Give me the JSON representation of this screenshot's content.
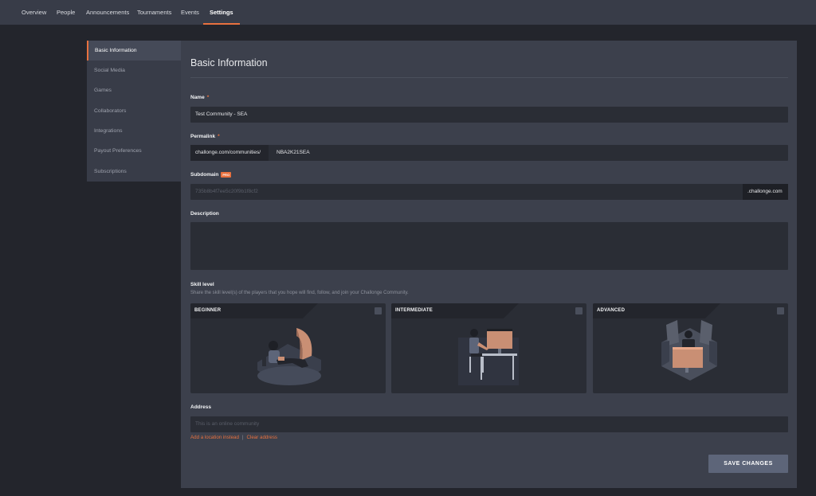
{
  "nav": {
    "tabs": [
      {
        "label": "Overview"
      },
      {
        "label": "People"
      },
      {
        "label": "Announcements"
      },
      {
        "label": "Tournaments"
      },
      {
        "label": "Events"
      },
      {
        "label": "Settings"
      }
    ],
    "active": "Settings"
  },
  "sidebar": {
    "items": [
      {
        "label": "Basic Information"
      },
      {
        "label": "Social Media"
      },
      {
        "label": "Games"
      },
      {
        "label": "Collaborators"
      },
      {
        "label": "Integrations"
      },
      {
        "label": "Payout Preferences"
      },
      {
        "label": "Subscriptions"
      }
    ],
    "active": "Basic Information"
  },
  "form": {
    "title": "Basic Information",
    "name": {
      "label": "Name",
      "required": "*",
      "value": "Test Community - SEA"
    },
    "permalink": {
      "label": "Permalink",
      "required": "*",
      "prefix": "challonge.com/communities/",
      "value": "NBA2K21SEA"
    },
    "subdomain": {
      "label": "Subdomain",
      "badge": "PRO",
      "placeholder": "735b8b4f7ee5c20f9b1f8cf2",
      "suffix": ".challonge.com"
    },
    "description": {
      "label": "Description",
      "value": ""
    },
    "skill": {
      "label": "Skill level",
      "help": "Share the skill level(s) of the players that you hope will find, follow, and join your Challonge Community.",
      "cards": [
        {
          "title": "BEGINNER",
          "icon": "beginner-gamer-illustration"
        },
        {
          "title": "INTERMEDIATE",
          "icon": "intermediate-gamer-illustration"
        },
        {
          "title": "ADVANCED",
          "icon": "advanced-gamer-illustration"
        }
      ]
    },
    "address": {
      "label": "Address",
      "placeholder": "This is an online community",
      "add_location": "Add a location instead",
      "separator": "|",
      "clear": "Clear address"
    },
    "save_label": "SAVE CHANGES"
  },
  "colors": {
    "accent": "#e8713f",
    "panel": "#3c404c",
    "nav": "#383c48",
    "background": "#23252c"
  }
}
